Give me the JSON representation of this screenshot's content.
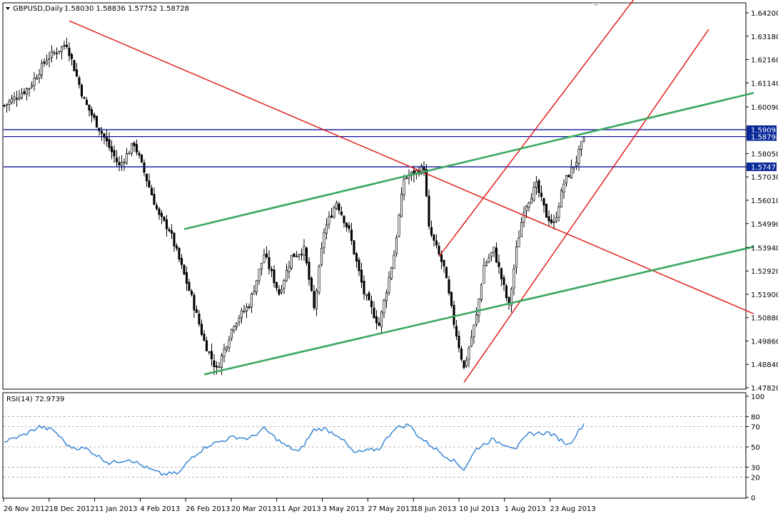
{
  "header": {
    "symbol": "GBPUSD,Daily",
    "ohlc": "1.58030 1.58836 1.57752 1.58728"
  },
  "rsi_label": "RSI(14) 72.9739",
  "colors": {
    "candle": "#000000",
    "trend_red": "#e01010",
    "trend_green": "#3aa860",
    "level_blue": "#1010a0",
    "rsi_line": "#3a87d6",
    "highlight_label": "#0a2a9a"
  },
  "chart_data": [
    {
      "type": "candlestick",
      "title": "GBPUSD,Daily",
      "ylim": [
        1.4782,
        1.642
      ],
      "y_ticks": [
        "1.64200",
        "1.63180",
        "1.62160",
        "1.61140",
        "1.60090",
        "1.59095",
        "1.58794",
        "1.58050",
        "1.57472",
        "1.57030",
        "1.56010",
        "1.54990",
        "1.53940",
        "1.52920",
        "1.51900",
        "1.50880",
        "1.49860",
        "1.48840",
        "1.47820"
      ],
      "highlighted_levels": [
        "1.59095",
        "1.58794",
        "1.57472"
      ],
      "x_ticks": [
        "26 Nov 2012",
        "18 Dec 2012",
        "11 Jan 2013",
        "4 Feb 2013",
        "26 Feb 2013",
        "20 Mar 2013",
        "11 Apr 2013",
        "3 May 2013",
        "27 May 2013",
        "18 Jun 2013",
        "10 Jul 2013",
        "1 Aug 2013",
        "23 Aug 2013"
      ],
      "close_path_bars": [
        0,
        10,
        17,
        25,
        32,
        40,
        46,
        52,
        58,
        62,
        66,
        75,
        80,
        85,
        92,
        98,
        104,
        110,
        115,
        120,
        124,
        128,
        133,
        138,
        144,
        150,
        156,
        160,
        168,
        170,
        176,
        180,
        184,
        189,
        192,
        196,
        202,
        205,
        208,
        213,
        217,
        220,
        224,
        229,
        232
      ],
      "close_path_values": [
        1.6015,
        1.6095,
        1.622,
        1.6285,
        1.6035,
        1.5875,
        1.575,
        1.585,
        1.566,
        1.553,
        1.5475,
        1.5175,
        1.4985,
        1.486,
        1.5065,
        1.5145,
        1.5365,
        1.5195,
        1.5355,
        1.5385,
        1.5125,
        1.5465,
        1.5595,
        1.5465,
        1.5195,
        1.5055,
        1.5365,
        1.5695,
        1.5745,
        1.5475,
        1.5305,
        1.5065,
        1.4865,
        1.5095,
        1.5315,
        1.5385,
        1.5135,
        1.5385,
        1.5565,
        1.5665,
        1.5535,
        1.5495,
        1.5675,
        1.5775,
        1.5873
      ],
      "trendlines": [
        {
          "color": "red",
          "from": [
            26,
            1.6385
          ],
          "to": [
            300,
            1.5105
          ]
        },
        {
          "color": "red",
          "from": [
            174,
            1.5355
          ],
          "to": [
            258,
            1.6565
          ]
        },
        {
          "color": "red",
          "from": [
            184,
            1.4805
          ],
          "to": [
            282,
            1.6348
          ]
        },
        {
          "color": "green",
          "from": [
            72,
            1.5475
          ],
          "to": [
            300,
            1.607
          ]
        },
        {
          "color": "green",
          "from": [
            80,
            1.484
          ],
          "to": [
            300,
            1.5398
          ]
        }
      ],
      "horizontal_levels": [
        1.59095,
        1.58794,
        1.57472
      ]
    },
    {
      "type": "line",
      "title": "RSI(14) 72.9739",
      "ylim": [
        0,
        100
      ],
      "y_ticks": [
        "100",
        "80",
        "70",
        "50",
        "30",
        "20",
        "0"
      ],
      "levels": [
        80,
        70,
        50,
        30,
        20
      ],
      "x": [
        0,
        8,
        14,
        20,
        26,
        33,
        42,
        50,
        58,
        63,
        70,
        75,
        82,
        86,
        92,
        98,
        104,
        112,
        118,
        124,
        128,
        134,
        140,
        150,
        156,
        162,
        166,
        176,
        180,
        184,
        189,
        195,
        205,
        210,
        218,
        226,
        232
      ],
      "values": [
        55,
        62,
        70,
        66,
        50,
        48,
        34,
        38,
        28,
        23,
        24,
        40,
        52,
        55,
        60,
        58,
        68,
        52,
        45,
        67,
        68,
        61,
        44,
        48,
        68,
        72,
        60,
        42,
        36,
        28,
        48,
        57,
        49,
        63,
        64,
        52,
        73
      ]
    }
  ]
}
